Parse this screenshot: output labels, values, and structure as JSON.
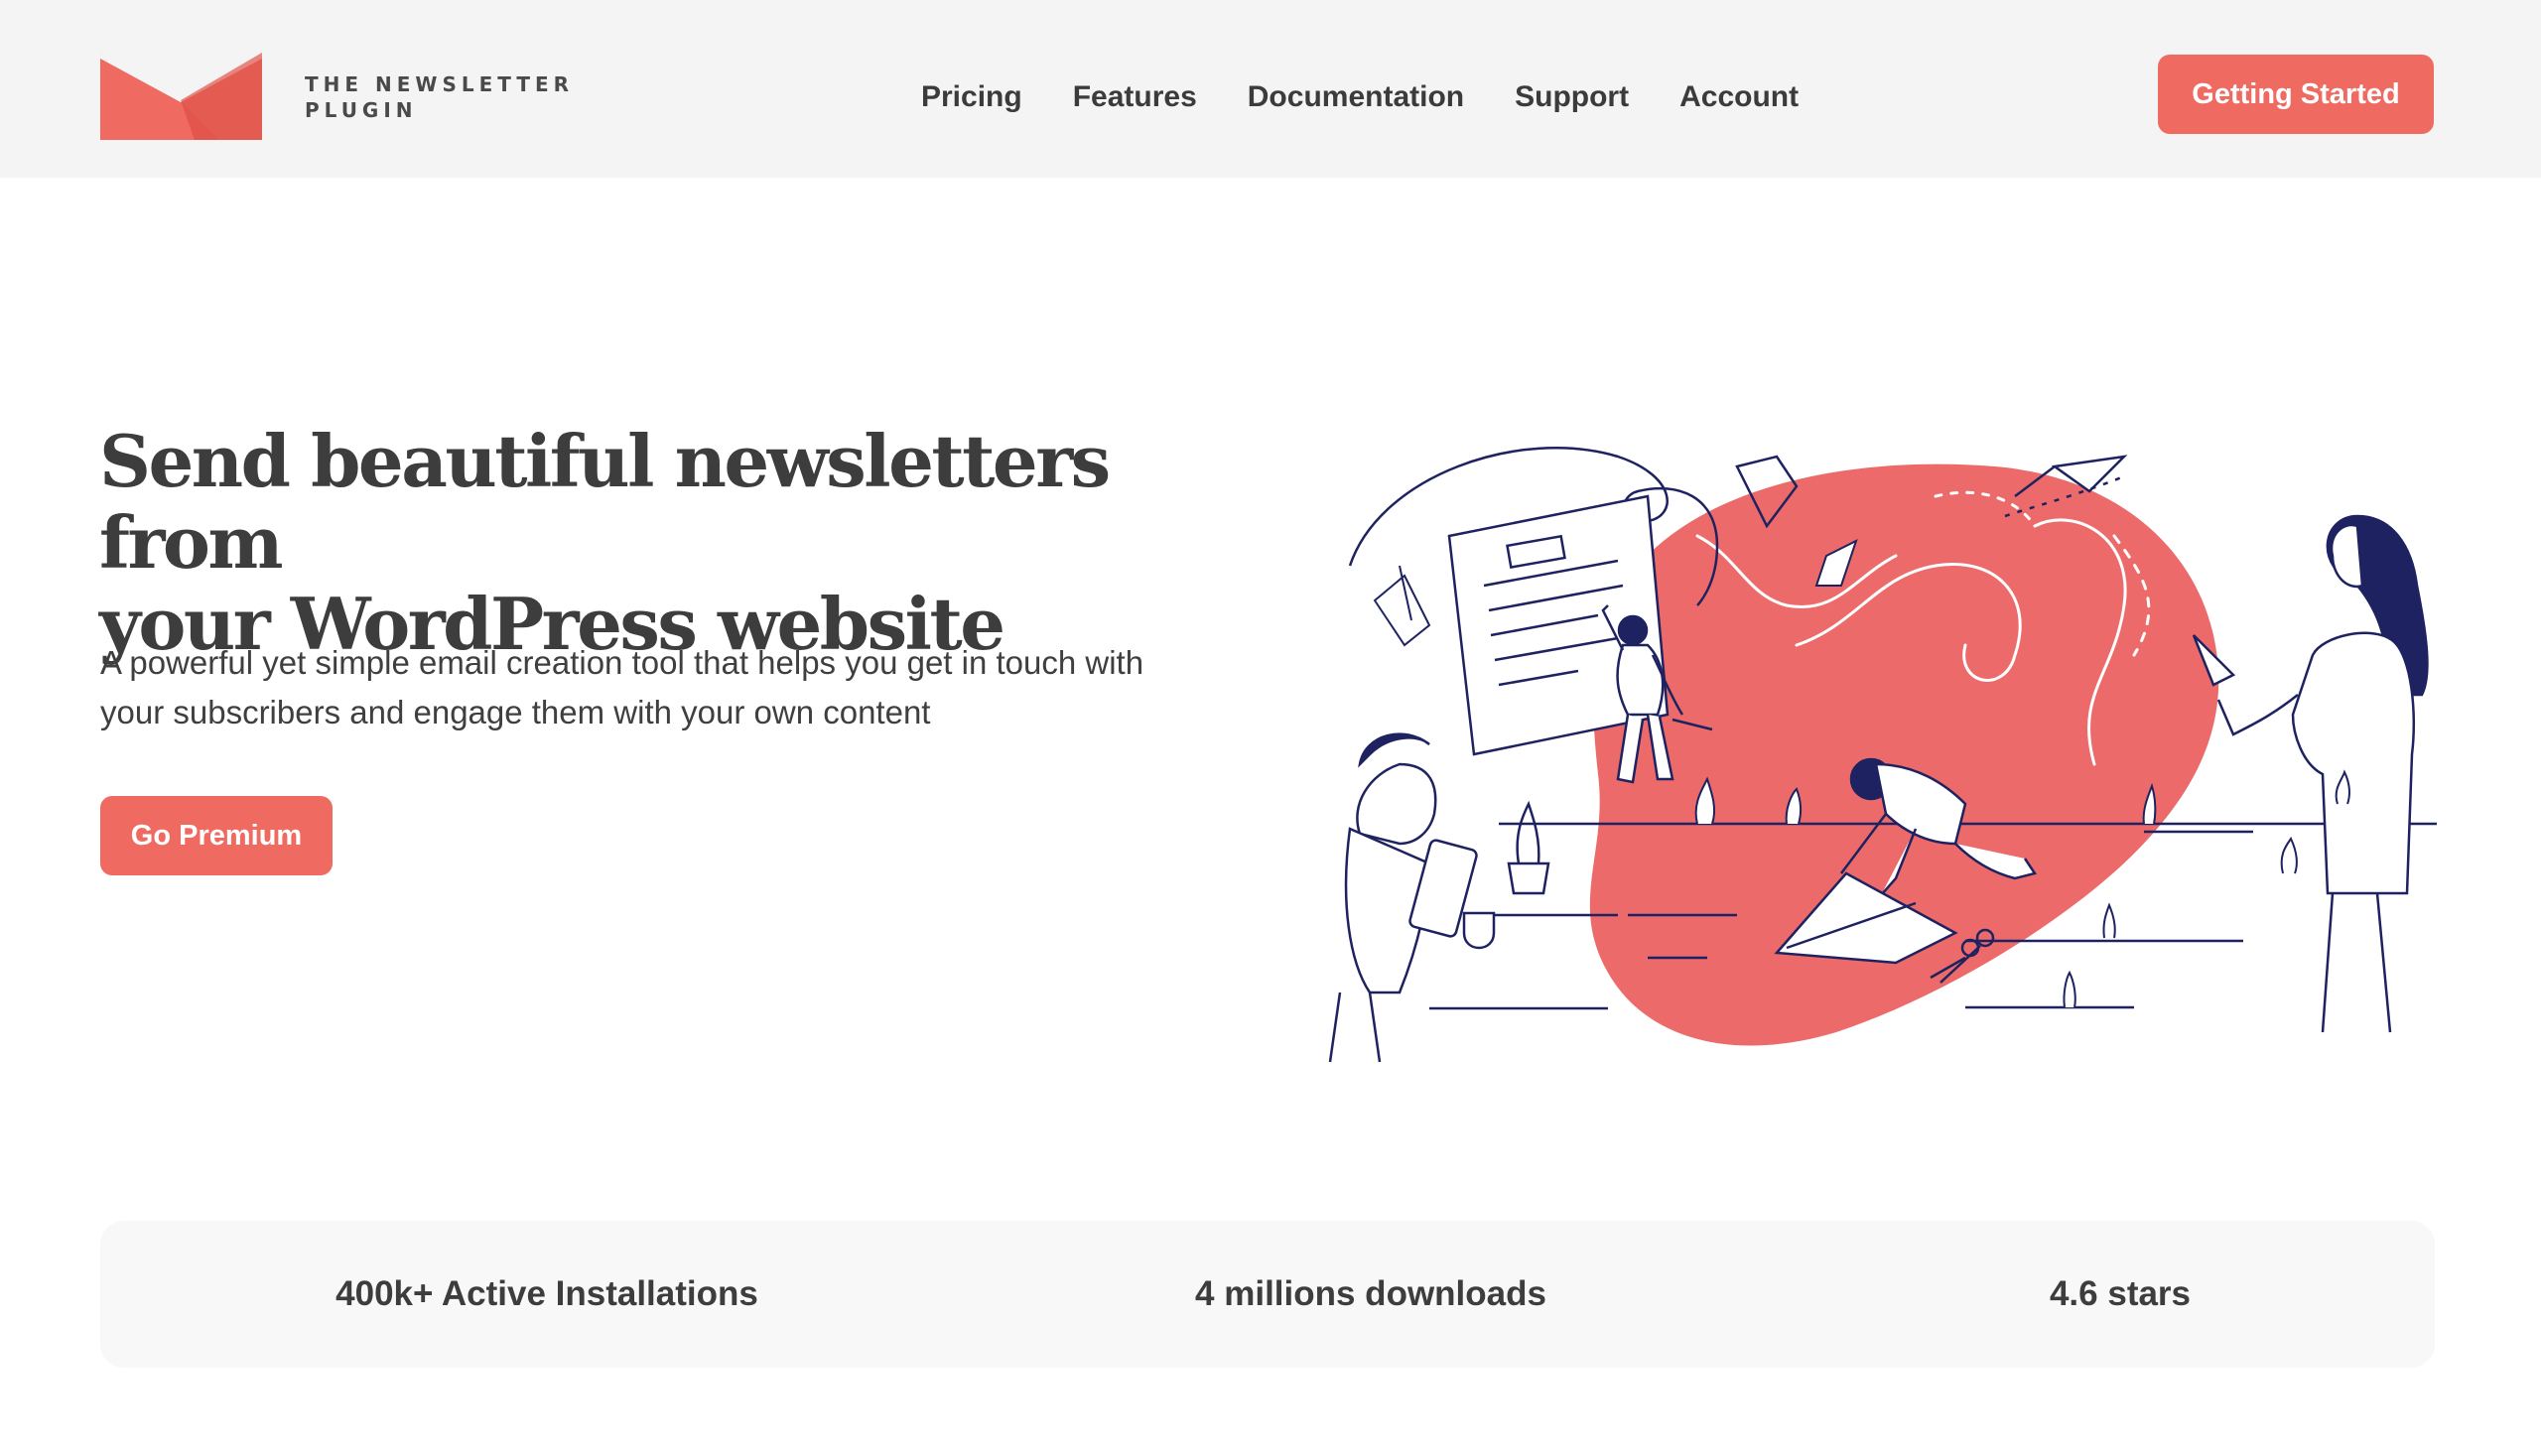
{
  "brand": {
    "name_line1": "THE NEWSLETTER",
    "name_line2": "PLUGIN",
    "accent_color": "#ef6b61",
    "navy_color": "#1e2260"
  },
  "nav": {
    "items": [
      "Pricing",
      "Features",
      "Documentation",
      "Support",
      "Account"
    ],
    "cta_label": "Getting Started"
  },
  "hero": {
    "title_line1": "Send beautiful newsletters from",
    "title_line2": "your WordPress website",
    "subtitle_line1": "A powerful yet simple email creation tool that helps you get in touch with",
    "subtitle_line2": "your subscribers and engage them with your own content",
    "cta_label": "Go Premium",
    "illustration_icon": "team-creating-newsletter-illustration"
  },
  "stats": {
    "items": [
      "400k+ Active Installations",
      "4 millions downloads",
      "4.6 stars"
    ]
  }
}
